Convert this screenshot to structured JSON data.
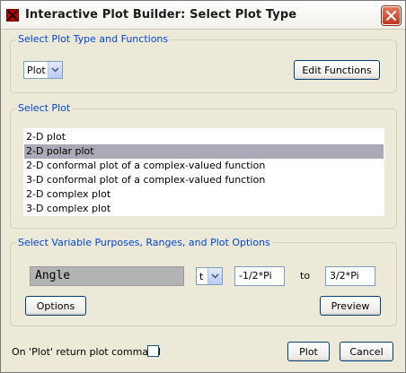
{
  "window": {
    "title": "Interactive Plot Builder: Select Plot Type"
  },
  "plot_type_group": {
    "title": "Select Plot Type and Functions",
    "plot_select_value": "Plot",
    "edit_functions_label": "Edit Functions"
  },
  "select_plot_group": {
    "title": "Select Plot",
    "items": [
      {
        "label": "2-D plot",
        "selected": false
      },
      {
        "label": "2-D polar plot",
        "selected": true
      },
      {
        "label": "2-D conformal plot of a complex-valued function",
        "selected": false
      },
      {
        "label": "3-D conformal plot of a complex-valued function",
        "selected": false
      },
      {
        "label": "2-D complex plot",
        "selected": false
      },
      {
        "label": "3-D complex plot",
        "selected": false
      }
    ]
  },
  "variable_group": {
    "title": "Select Variable Purposes, Ranges, and Plot Options",
    "purpose_value": "Angle",
    "variable_select_value": "t",
    "range_from": "-1/2*Pi",
    "to_label": "to",
    "range_to": "3/2*Pi",
    "options_label": "Options",
    "preview_label": "Preview"
  },
  "footer": {
    "return_command_label": "On 'Plot' return plot command",
    "return_command_checked": false,
    "plot_label": "Plot",
    "cancel_label": "Cancel"
  },
  "icons": {
    "app": "maple-app-icon",
    "close": "close-icon",
    "dropdown": "chevron-down-icon"
  },
  "colors": {
    "group_title": "#0046d5",
    "selection": "#aaa9b8",
    "close_button": "#c0361c"
  }
}
